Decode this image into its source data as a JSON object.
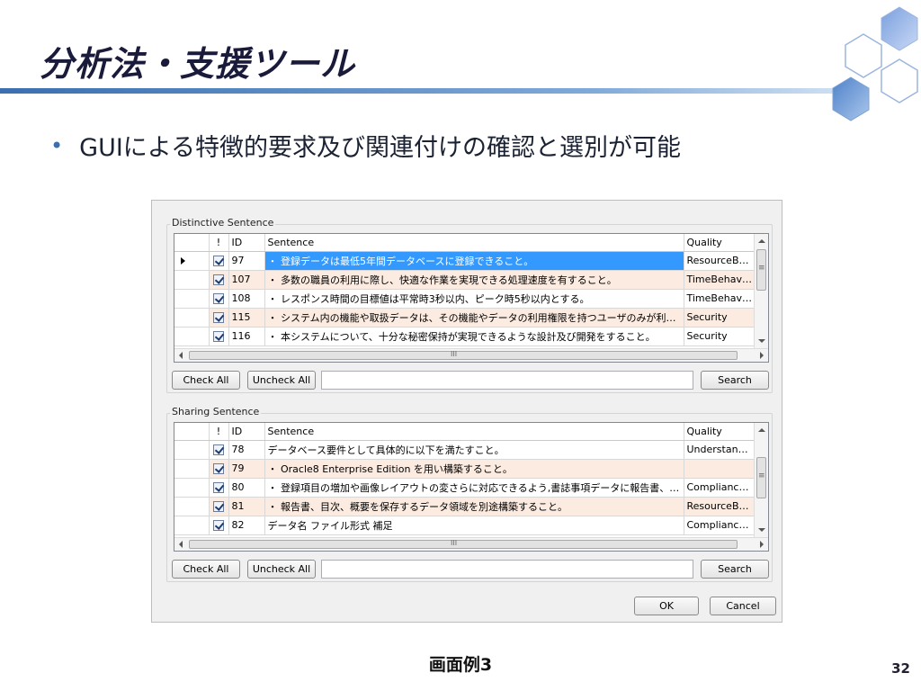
{
  "slide": {
    "title": "分析法・支援ツール",
    "bullet": "GUIによる特徴的要求及び関連付けの確認と選別が可能",
    "caption": "画面例3",
    "page_number": "32",
    "accent_color": "#3b6fb0"
  },
  "dialog": {
    "distinctive": {
      "group_label": "Distinctive Sentence",
      "columns": [
        "!",
        "ID",
        "Sentence",
        "Quality"
      ],
      "rows": [
        {
          "checked": true,
          "id": "97",
          "sentence": "・ 登録データは最低5年間データベースに登録できること。",
          "quality": "ResourceBeha",
          "selected": true
        },
        {
          "checked": true,
          "id": "107",
          "sentence": "・ 多数の職員の利用に際し、快適な作業を実現できる処理速度を有すること。",
          "quality": "TimeBehaviou"
        },
        {
          "checked": true,
          "id": "108",
          "sentence": "・ レスポンス時間の目標値は平常時3秒以内、ピーク時5秒以内とする。",
          "quality": "TimeBehaviou"
        },
        {
          "checked": true,
          "id": "115",
          "sentence": "・ システム内の機能や取扱データは、その機能やデータの利用権限を持つユーザのみが利用…",
          "quality": "Security"
        },
        {
          "checked": true,
          "id": "116",
          "sentence": "・ 本システムについて、十分な秘密保持が実現できるような設計及び開発をすること。",
          "quality": "Security"
        }
      ],
      "check_all": "Check All",
      "uncheck_all": "Uncheck All",
      "search_value": "",
      "search_button": "Search"
    },
    "sharing": {
      "group_label": "Sharing Sentence",
      "columns": [
        "!",
        "ID",
        "Sentence",
        "Quality"
      ],
      "rows": [
        {
          "checked": true,
          "id": "78",
          "sentence": "データベース要件として具体的に以下を満たすこと。",
          "quality": "Understandabi"
        },
        {
          "checked": true,
          "id": "79",
          "sentence": "・ Oracle8 Enterprise Edition を用い構築すること。",
          "quality": ""
        },
        {
          "checked": true,
          "id": "80",
          "sentence": "・ 登録項目の増加や画像レイアウトの変さらに対応できるよう,書誌事項データに報告書、目…",
          "quality": "Compliance, C"
        },
        {
          "checked": true,
          "id": "81",
          "sentence": "・ 報告書、目次、概要を保存するデータ領域を別途構築すること。",
          "quality": "ResourceBeha"
        },
        {
          "checked": true,
          "id": "82",
          "sentence": "データ名 ファイル形式 補足",
          "quality": "Compliance, C"
        }
      ],
      "check_all": "Check All",
      "uncheck_all": "Uncheck All",
      "search_value": "",
      "search_button": "Search"
    },
    "ok_button": "OK",
    "cancel_button": "Cancel"
  }
}
